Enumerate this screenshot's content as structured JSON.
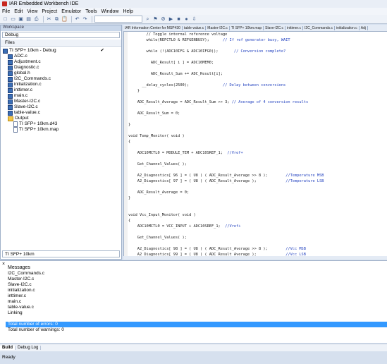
{
  "window": {
    "title": "IAR Embedded Workbench IDE"
  },
  "menu": [
    "File",
    "Edit",
    "View",
    "Project",
    "Emulator",
    "Tools",
    "Window",
    "Help"
  ],
  "toolbar": {
    "search_value": "",
    "icons": [
      "new-file-icon",
      "open-icon",
      "save-icon",
      "save-all-icon",
      "print-icon",
      "cut-icon",
      "copy-icon",
      "paste-icon",
      "undo-icon",
      "redo-icon",
      "find-icon",
      "bookmark-icon",
      "compile-icon",
      "make-icon",
      "stop-build-icon",
      "debug-icon",
      "download-icon"
    ]
  },
  "workspace": {
    "title": "Workspace",
    "config": "Debug",
    "files_header": "Files",
    "tree": [
      {
        "label": "TI SFP+ 10km - Debug",
        "kind": "project",
        "check": "✔"
      },
      {
        "label": "ADC.c",
        "kind": "file"
      },
      {
        "label": "Adjustment.c",
        "kind": "file"
      },
      {
        "label": "Diagnostic.c",
        "kind": "file"
      },
      {
        "label": "global.h",
        "kind": "file"
      },
      {
        "label": "I2C_Commands.c",
        "kind": "file"
      },
      {
        "label": "initialization.c",
        "kind": "file"
      },
      {
        "label": "inttimer.c",
        "kind": "file"
      },
      {
        "label": "main.c",
        "kind": "file"
      },
      {
        "label": "Master-I2C.c",
        "kind": "file"
      },
      {
        "label": "Slave-I2C.c",
        "kind": "file"
      },
      {
        "label": "table-value.c",
        "kind": "file"
      },
      {
        "label": "Output",
        "kind": "folder"
      },
      {
        "label": "TI SFP+ 10km.d43",
        "kind": "output"
      },
      {
        "label": "TI SFP+ 10km.map",
        "kind": "output"
      }
    ],
    "footer": "TI SFP+ 10km"
  },
  "editor": {
    "tabs": [
      "IAR Information Center for MSP430",
      "table-value.c",
      "Master-I2C.c",
      "TI SFP+ 10km.map",
      "Slave-I2C.c",
      "inttimer.c",
      "I2C_Commands.c",
      "initialization.c",
      "Adj"
    ],
    "lines": [
      {
        "code": "        // Toggle internal reference voltage",
        "comment": ""
      },
      {
        "code": "        while(REFCTL0 & REFGENBUSY);",
        "comment": "      // If ref generator busy, WAIT"
      },
      {
        "code": "",
        "comment": ""
      },
      {
        "code": "        while (!(ADC10IFG & ADC10IFG0));",
        "comment": "       // Conversion complete?"
      },
      {
        "code": "",
        "comment": ""
      },
      {
        "code": "          ADC_Result[ i ] = ADC10MEM0;",
        "comment": ""
      },
      {
        "code": "",
        "comment": ""
      },
      {
        "code": "          ADC_Result_Sum += ADC_Result[i];",
        "comment": ""
      },
      {
        "code": "",
        "comment": ""
      },
      {
        "code": "      __delay_cycles(2500);",
        "comment": "               // Delay between conversions"
      },
      {
        "code": "    }",
        "comment": ""
      },
      {
        "code": "",
        "comment": ""
      },
      {
        "code": "    ADC_Result_Average = ADC_Result_Sum >> 3;",
        "comment": " // Average of 4 conversion results"
      },
      {
        "code": "",
        "comment": ""
      },
      {
        "code": "    ADC_Result_Sum = 0;",
        "comment": ""
      },
      {
        "code": "",
        "comment": ""
      },
      {
        "code": "}",
        "comment": ""
      },
      {
        "code": "",
        "comment": ""
      },
      {
        "code": "void Temp_Monitor( void )",
        "comment": ""
      },
      {
        "code": "{",
        "comment": ""
      },
      {
        "code": "",
        "comment": ""
      },
      {
        "code": "    ADC10MCTL0 = MODULE_TEM + ADC10SREF_1;",
        "comment": "  //Vref+"
      },
      {
        "code": "",
        "comment": ""
      },
      {
        "code": "    Get_Channel_Values( );",
        "comment": ""
      },
      {
        "code": "",
        "comment": ""
      },
      {
        "code": "    A2_Diagnostics[ 96 ] = ( U8 ) ( ADC_Result_Average >> 8 );",
        "comment": "        //Temperature MSB"
      },
      {
        "code": "    A2_Diagnostics[ 97 ] = ( U8 ) ( ADC_Result_Average );",
        "comment": "             //Temperature LSB"
      },
      {
        "code": "",
        "comment": ""
      },
      {
        "code": "    ADC_Result_Average = 0;",
        "comment": ""
      },
      {
        "code": "}",
        "comment": ""
      },
      {
        "code": "",
        "comment": ""
      },
      {
        "code": "",
        "comment": ""
      },
      {
        "code": "void Vcc_Input_Monitor( void )",
        "comment": ""
      },
      {
        "code": "{",
        "comment": ""
      },
      {
        "code": "    ADC10MCTL0 = VCC_INPUT + ADC10SREF_1;",
        "comment": "  //Vref+"
      },
      {
        "code": "",
        "comment": ""
      },
      {
        "code": "    Get_Channel_Values( );",
        "comment": ""
      },
      {
        "code": "",
        "comment": ""
      },
      {
        "code": "    A2_Diagnostics[ 98 ] = ( U8 ) ( ADC_Result_Average >> 8 );",
        "comment": "        //Vcc MSB"
      },
      {
        "code": "    A2_Diagnostics[ 99 ] = ( U8 ) ( ADC_Result_Average );",
        "comment": "             //Vcc LSB"
      }
    ]
  },
  "messages": {
    "header": "Messages",
    "rows": [
      "I2C_Commands.c",
      "Master-I2C.c",
      "Slave-I2C.c",
      "initialization.c",
      "inttimer.c",
      "main.c",
      "table-value.c",
      "Linking",
      "",
      "Total number of errors: 0",
      "Total number of warnings: 0"
    ],
    "selected_index": 9
  },
  "bottom_tabs": [
    "Build",
    "Debug Log"
  ],
  "status": "Ready",
  "colors": {
    "selection": "#3399ff",
    "comment": "#1f3fbf"
  }
}
